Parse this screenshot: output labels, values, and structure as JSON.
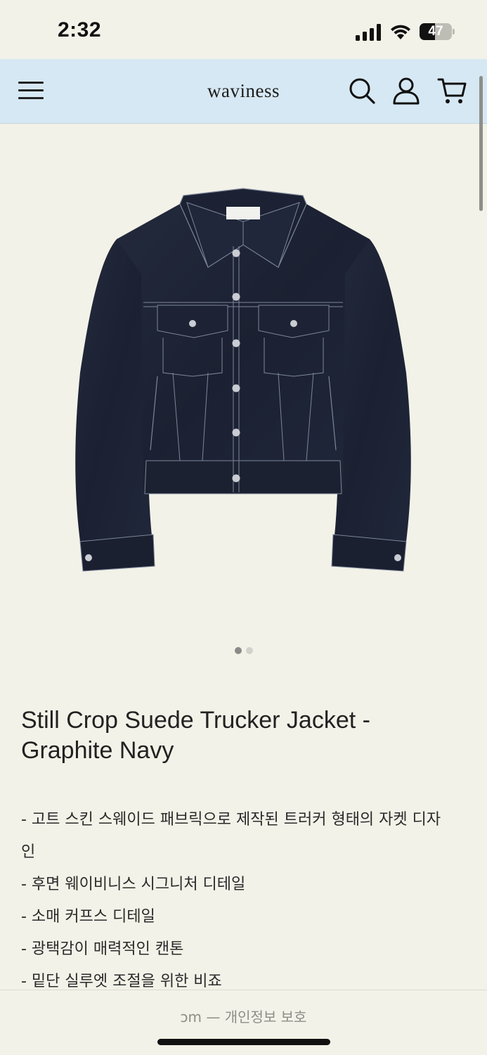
{
  "status_bar": {
    "time": "2:32",
    "battery_percent": "47",
    "battery_level": 0.47,
    "signal_icon": "cellular-signal-icon",
    "wifi_icon": "wifi-icon"
  },
  "header": {
    "logo": "waviness",
    "menu_icon": "hamburger-menu-icon",
    "search_icon": "search-icon",
    "account_icon": "account-icon",
    "cart_icon": "cart-icon",
    "background": "#d6e8f3"
  },
  "product": {
    "image_alt": "Navy suede trucker jacket",
    "carousel": {
      "current": 1,
      "total": 2
    },
    "title": "Still Crop Suede Trucker Jacket - Graphite Navy",
    "description": [
      "- 고트 스킨 스웨이드 패브릭으로 제작된 트러커 형태의 자켓 디자",
      "인",
      "- 후면 웨이비니스 시그니처 디테일",
      "- 소매 커프스 디테일",
      "- 광택감이 매력적인 캔톤",
      "- 밑단 실루엣 조절을 위한 비죠"
    ]
  },
  "bottom_bar": {
    "text": "ɔm — 개인정보 보호"
  },
  "colors": {
    "page_background": "#f3f2e8",
    "jacket": "#1d2233",
    "stitching": "#8e97a8"
  }
}
